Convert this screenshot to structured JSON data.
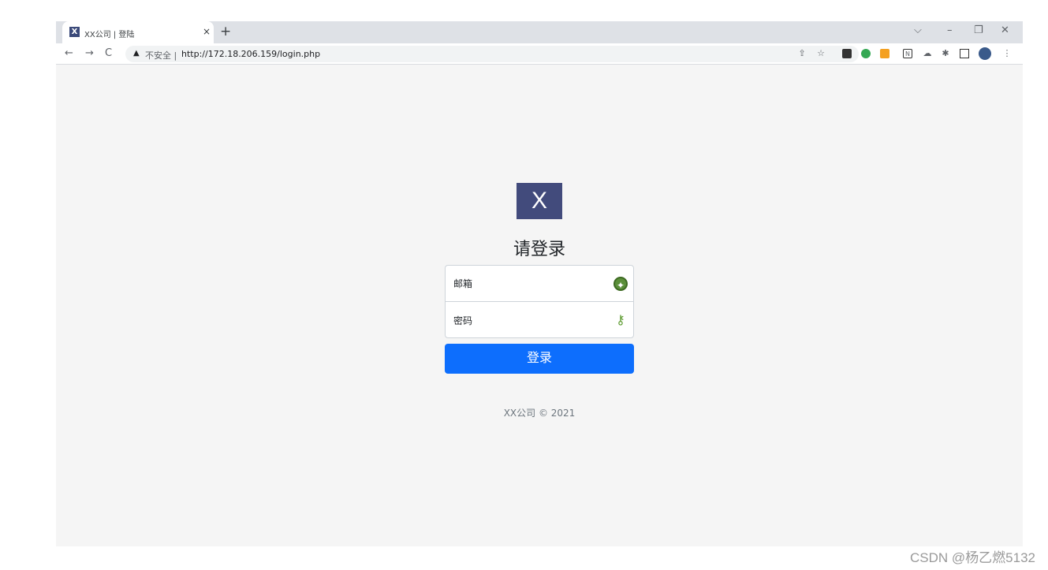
{
  "browser": {
    "tab_title": "XX公司 | 登陆",
    "tab_favicon": "X",
    "tab_close": "×",
    "new_tab": "+",
    "window_controls": {
      "tabsearch": "⌵",
      "minimize": "–",
      "restore": "❐",
      "close": "✕"
    },
    "nav": {
      "back": "←",
      "forward": "→",
      "reload": "C"
    },
    "security_label": "不安全 |",
    "url": "http://172.18.206.159/login.php",
    "toolbar_icons": [
      "share-icon",
      "bookmark-star-icon",
      "extension-1-icon",
      "extension-2-icon",
      "extension-240-icon",
      "notion-icon",
      "cloud-icon",
      "extensions-puzzle-icon",
      "sidepanel-icon",
      "profile-avatar-icon",
      "menu-icon"
    ]
  },
  "page": {
    "logo_text": "X",
    "heading": "请登录",
    "email_label": "邮箱",
    "password_label": "密码",
    "login_button": "登录",
    "footer": "XX公司 © 2021"
  },
  "watermark": "CSDN @杨乙燃5132",
  "colors": {
    "logo_bg": "#424b7c",
    "button_bg": "#0d6efd",
    "page_bg": "#f5f5f5"
  }
}
